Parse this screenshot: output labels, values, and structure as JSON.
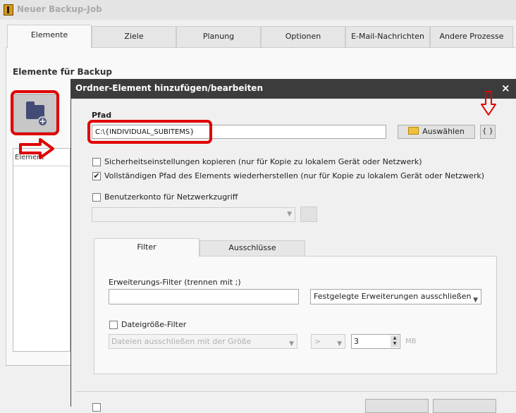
{
  "window": {
    "title": "Neuer Backup-Job"
  },
  "main_tabs": [
    "Elemente",
    "Ziele",
    "Planung",
    "Optionen",
    "E-Mail-Nachrichten",
    "Andere Prozesse"
  ],
  "elements_panel": {
    "heading": "Elemente für Backup",
    "column_header": "Element"
  },
  "dialog": {
    "title": "Ordner-Element hinzufügen/bearbeiten",
    "close": "×",
    "path_label": "Pfad",
    "path_value": "C:\\{INDIVIDUAL_SUBITEMS}",
    "browse_label": "Auswählen",
    "variables_label": "{ }",
    "checkboxes": {
      "copy_security": {
        "label": "Sicherheitseinstellungen kopieren (nur für Kopie zu lokalem Gerät oder Netzwerk)",
        "checked": false
      },
      "restore_full_path": {
        "label": "Vollständigen Pfad des Elements wiederherstellen (nur für Kopie zu lokalem Gerät oder Netzwerk)",
        "checked": true
      },
      "network_account": {
        "label": "Benutzerkonto für Netzwerkzugriff",
        "checked": false
      }
    },
    "check_mark": "✔",
    "tabs": [
      "Filter",
      "Ausschlüsse"
    ],
    "filter": {
      "ext_label": "Erweiterungs-Filter (trennen mit ;)",
      "ext_value": "",
      "ext_mode": "Festgelegte Erweiterungen ausschließen",
      "size_filter_label": "Dateigröße-Filter",
      "size_filter_checked": false,
      "size_mode": "Dateien ausschließen mit der Größe",
      "comparator": ">",
      "size_value": "3",
      "unit": "MB"
    }
  },
  "annotation_color": "#e00000"
}
